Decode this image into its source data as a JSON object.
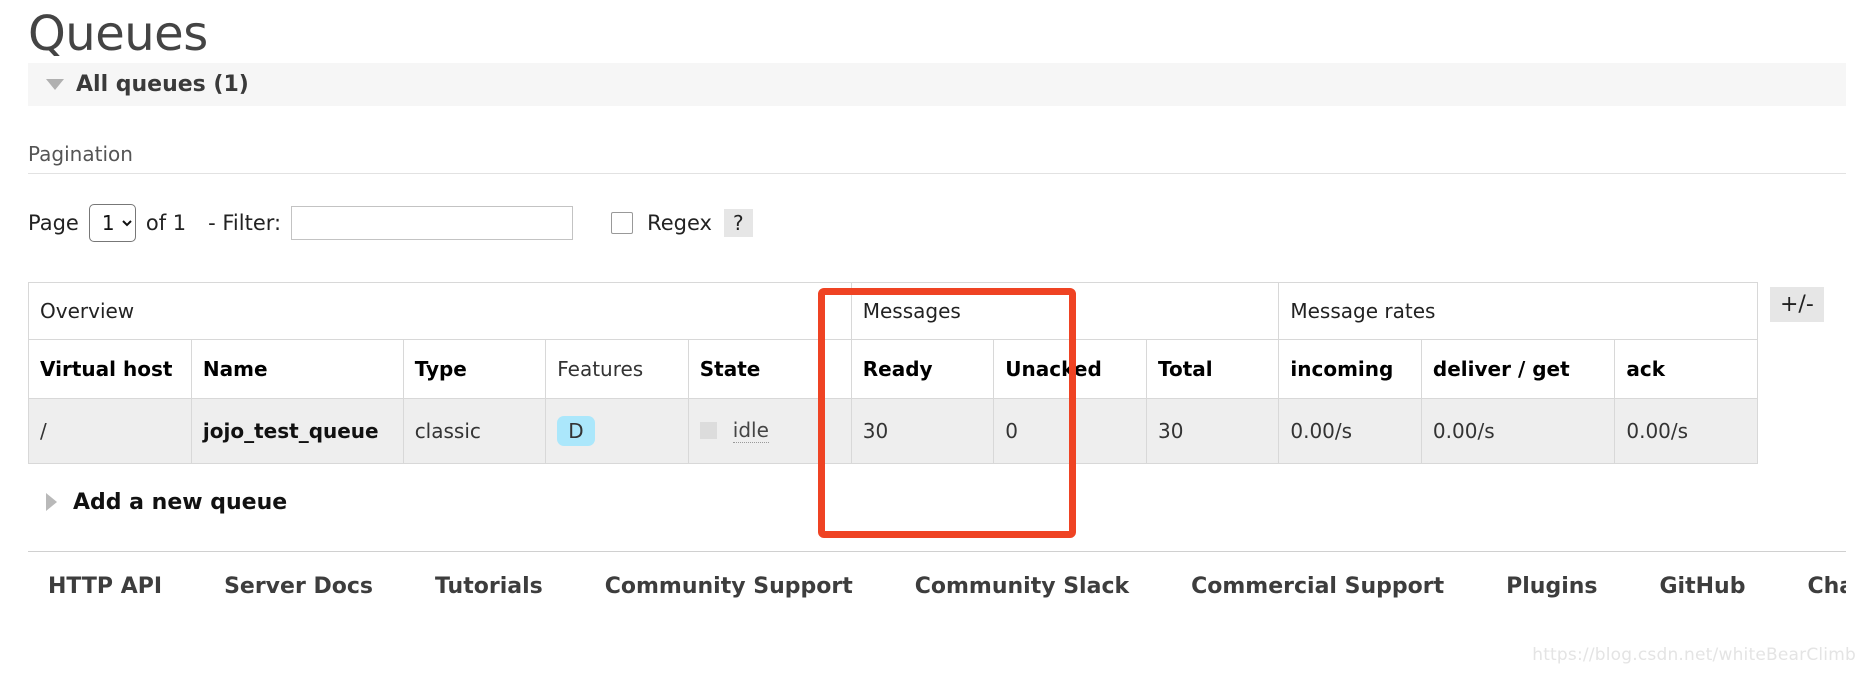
{
  "page": {
    "title": "Queues"
  },
  "section": {
    "toggle_icon": "triangle-down-icon",
    "label": "All queues (1)"
  },
  "pagination": {
    "heading": "Pagination",
    "page_label": "Page",
    "page_value": "1",
    "page_options": [
      "1"
    ],
    "of_label": "of 1",
    "filter_label": "- Filter:",
    "filter_value": "",
    "filter_placeholder": "",
    "regex_label": "Regex",
    "regex_checked": false,
    "help_label": "?"
  },
  "table": {
    "group_headers": [
      {
        "label": "Overview",
        "span": 5
      },
      {
        "label": "Messages",
        "span": 3
      },
      {
        "label": "Message rates",
        "span": 3
      }
    ],
    "columns": [
      {
        "label": "Virtual host",
        "bold": true,
        "align": "left"
      },
      {
        "label": "Name",
        "bold": true,
        "align": "left"
      },
      {
        "label": "Type",
        "bold": true,
        "align": "left"
      },
      {
        "label": "Features",
        "bold": false,
        "align": "left"
      },
      {
        "label": "State",
        "bold": true,
        "align": "left"
      },
      {
        "label": "Ready",
        "bold": true,
        "align": "left"
      },
      {
        "label": "Unacked",
        "bold": true,
        "align": "left"
      },
      {
        "label": "Total",
        "bold": true,
        "align": "left"
      },
      {
        "label": "incoming",
        "bold": true,
        "align": "left"
      },
      {
        "label": "deliver / get",
        "bold": true,
        "align": "left"
      },
      {
        "label": "ack",
        "bold": true,
        "align": "left"
      }
    ],
    "rows": [
      {
        "virtual_host": "/",
        "name": "jojo_test_queue",
        "type": "classic",
        "features": "D",
        "state": "idle",
        "ready": "30",
        "unacked": "0",
        "total": "30",
        "incoming": "0.00/s",
        "deliver_get": "0.00/s",
        "ack": "0.00/s"
      }
    ],
    "toggle_columns_label": "+/-"
  },
  "add_queue": {
    "toggle_icon": "triangle-right-icon",
    "label": "Add a new queue"
  },
  "footer": {
    "links": [
      "HTTP API",
      "Server Docs",
      "Tutorials",
      "Community Support",
      "Community Slack",
      "Commercial Support",
      "Plugins",
      "GitHub",
      "Chan"
    ]
  },
  "watermark": {
    "text": "https://blog.csdn.net/whiteBearClimb"
  },
  "colors": {
    "annotation": "#ef4323",
    "feature_badge": "#abe7fb",
    "row_background": "#eeeeee",
    "section_background": "#f6f6f6"
  }
}
